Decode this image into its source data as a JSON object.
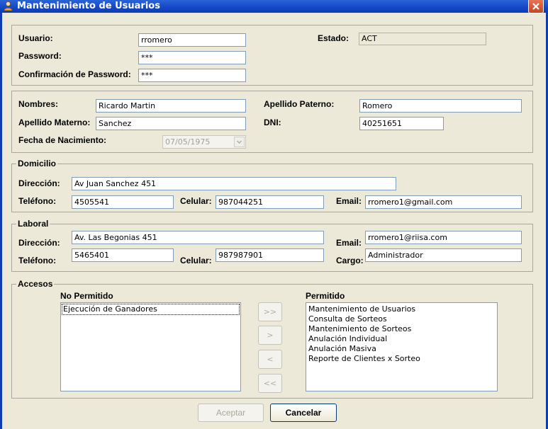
{
  "window": {
    "title": "Mantenimiento de Usuarios"
  },
  "icons": {
    "app": "user-icon",
    "close": "close-icon",
    "combo": "chevron-down-icon"
  },
  "cuenta": {
    "usuario_label": "Usuario:",
    "usuario_value": "rromero",
    "password_label": "Password:",
    "password_value": "***",
    "confirm_label": "Confirmación de Password:",
    "confirm_value": "***",
    "estado_label": "Estado:",
    "estado_value": "ACT"
  },
  "personal": {
    "nombres_label": "Nombres:",
    "nombres_value": "Ricardo Martin",
    "ap_paterno_label": "Apellido Paterno:",
    "ap_paterno_value": "Romero",
    "ap_materno_label": "Apellido Materno:",
    "ap_materno_value": "Sanchez",
    "dni_label": "DNI:",
    "dni_value": "40251651",
    "fecha_label": "Fecha de Nacimiento:",
    "fecha_value": "07/05/1975"
  },
  "domicilio": {
    "caption": "Domicilio",
    "direccion_label": "Dirección:",
    "direccion_value": "Av Juan Sanchez 451",
    "telefono_label": "Teléfono:",
    "telefono_value": "4505541",
    "celular_label": "Celular:",
    "celular_value": "987044251",
    "email_label": "Email:",
    "email_value": "rromero1@gmail.com"
  },
  "laboral": {
    "caption": "Laboral",
    "direccion_label": "Dirección:",
    "direccion_value": "Av. Las Begonias 451",
    "email_label": "Email:",
    "email_value": "rromero1@riisa.com",
    "telefono_label": "Teléfono:",
    "telefono_value": "5465401",
    "celular_label": "Celular:",
    "celular_value": "987987901",
    "cargo_label": "Cargo:",
    "cargo_value": "Administrador"
  },
  "accesos": {
    "caption": "Accesos",
    "no_permitido_label": "No Permitido",
    "no_permitido_items": [
      "Ejecución de Ganadores"
    ],
    "permitido_label": "Permitido",
    "permitido_items": [
      "Mantenimiento de Usuarios",
      "Consulta de Sorteos",
      "Mantenimiento de Sorteos",
      "Anulación Individual",
      "Anulación Masiva",
      "Reporte de Clientes x Sorteo"
    ],
    "move_all_right": ">>",
    "move_right": ">",
    "move_left": "<",
    "move_all_left": "<<"
  },
  "buttons": {
    "aceptar": "Aceptar",
    "cancelar": "Cancelar"
  }
}
